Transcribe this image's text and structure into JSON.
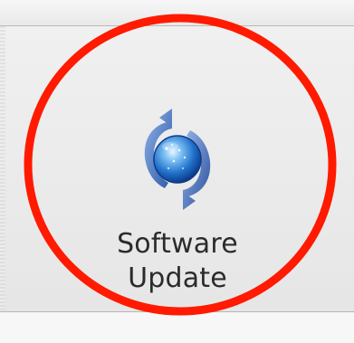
{
  "preference_item": {
    "label_line_1": "Software",
    "label_line_2": "Update",
    "icon": "software-update-icon"
  },
  "annotation": {
    "shape": "circle",
    "color": "#ff1a00"
  }
}
